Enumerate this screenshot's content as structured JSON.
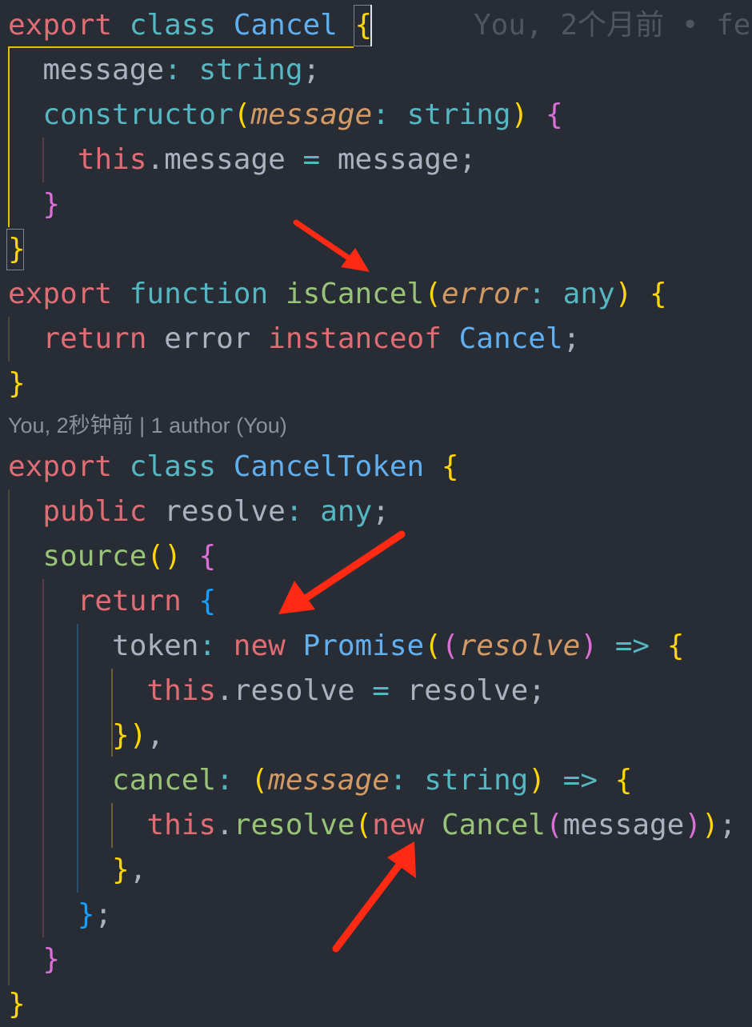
{
  "editor": {
    "inline_blame": "You, 2个月前 • fe",
    "codelens": "You, 2秒钟前 | 1 author (You)",
    "lines": [
      "export class Cancel {",
      "message: string;",
      "constructor(message: string) {",
      "this.message = message;",
      "}",
      "}",
      "export function isCancel(error: any) {",
      "return error instanceof Cancel;",
      "}",
      "export class CancelToken {",
      "public resolve: any;",
      "source() {",
      "return {",
      "token: new Promise((resolve) => {",
      "this.resolve = resolve;",
      "}),",
      "cancel: (message: string) => {",
      "this.resolve(new Cancel(message));",
      "},",
      "};",
      "}",
      "}"
    ]
  },
  "colors": {
    "background": "#282c34",
    "keyword": "#e06c75",
    "type": "#61afef",
    "function": "#98c379",
    "annotation_arrow": "#ff2a14"
  }
}
